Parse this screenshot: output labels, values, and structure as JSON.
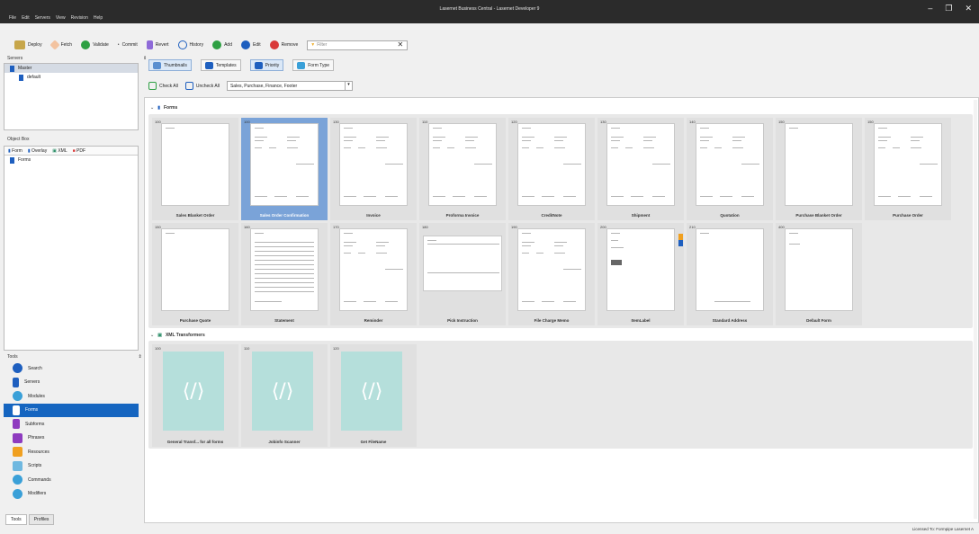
{
  "app": {
    "title": "Lasernet Business Central - Lasernet Developer 9",
    "menu": [
      "File",
      "Edit",
      "Servers",
      "View",
      "Revision",
      "Help"
    ],
    "window_buttons": [
      "–",
      "❐",
      "✕"
    ]
  },
  "toolbar": {
    "deploy": "Deploy",
    "fetch": "Fetch",
    "validate": "Validate",
    "commit": "Commit",
    "revert": "Revert",
    "history": "History",
    "add": "Add",
    "edit": "Edit",
    "remove": "Remove",
    "filter_placeholder": "Filter",
    "clear_icon": "✕"
  },
  "servers": {
    "header": "Servers",
    "pin": "⇕",
    "items": [
      {
        "label": "Master"
      },
      {
        "label": "default"
      }
    ]
  },
  "object_box": {
    "header": "Object Box",
    "pin": "⇕",
    "tabs": [
      "Form",
      "Overlay",
      "XML",
      "PDF"
    ],
    "items": [
      {
        "label": "Forms"
      }
    ]
  },
  "tools": {
    "header": "Tools",
    "pin": "⇕",
    "items": [
      {
        "label": "Search",
        "color": "#1e5fbf"
      },
      {
        "label": "Servers",
        "color": "#1e5fbf"
      },
      {
        "label": "Modules",
        "color": "#3aa0d8"
      },
      {
        "label": "Forms",
        "color": "#ffffff"
      },
      {
        "label": "Subforms",
        "color": "#8e3bbf"
      },
      {
        "label": "Phrases",
        "color": "#8e3bbf"
      },
      {
        "label": "Resources",
        "color": "#f0a020"
      },
      {
        "label": "Scripts",
        "color": "#3aa0d8"
      },
      {
        "label": "Commands",
        "color": "#3aa0d8"
      },
      {
        "label": "Modifiers",
        "color": "#3aa0d8"
      }
    ],
    "active_index": 3,
    "bottom_tabs": [
      "Tools",
      "Profiles"
    ]
  },
  "view": {
    "thumbnails": "Thumbnails",
    "templates": "Templates",
    "priority": "Priority",
    "form_type": "Form Type"
  },
  "check": {
    "check_all": "Check All",
    "uncheck_all": "Uncheck All",
    "combo_value": "Sales, Purchase, Finance, Footer"
  },
  "forms_group": {
    "label": "Forms",
    "cards": [
      {
        "priority": "100",
        "name": "Sales Blanket Order",
        "kind": "blank"
      },
      {
        "priority": "100",
        "name": "Sales Order Confirmation",
        "kind": "doc",
        "selected": true
      },
      {
        "priority": "130",
        "name": "Invoice",
        "kind": "doc"
      },
      {
        "priority": "110",
        "name": "Proforma Invoice",
        "kind": "doc"
      },
      {
        "priority": "120",
        "name": "CreditNote",
        "kind": "doc"
      },
      {
        "priority": "130",
        "name": "Shipment",
        "kind": "doc"
      },
      {
        "priority": "140",
        "name": "Quotation",
        "kind": "doc"
      },
      {
        "priority": "150",
        "name": "Purchase Blanket Order",
        "kind": "blank"
      },
      {
        "priority": "150",
        "name": "Purchase Order",
        "kind": "doc"
      },
      {
        "priority": "150",
        "name": "Purchase Quote",
        "kind": "blank"
      },
      {
        "priority": "160",
        "name": "Statement",
        "kind": "table"
      },
      {
        "priority": "170",
        "name": "Reminder",
        "kind": "doc"
      },
      {
        "priority": "180",
        "name": "Pick Instruction",
        "kind": "wide"
      },
      {
        "priority": "190",
        "name": "File Charge Memo",
        "kind": "doc"
      },
      {
        "priority": "200",
        "name": "ItemLabel",
        "kind": "label"
      },
      {
        "priority": "210",
        "name": "Standard Address",
        "kind": "blank"
      },
      {
        "priority": "400",
        "name": "Default Form",
        "kind": "blank"
      }
    ]
  },
  "xml_group": {
    "label": "XML Transformers",
    "glyph": "⟨/⟩",
    "cards": [
      {
        "priority": "100",
        "name": "General Transf... for all forms"
      },
      {
        "priority": "110",
        "name": "Jobinfo Scanner"
      },
      {
        "priority": "120",
        "name": "Get FileName"
      }
    ]
  },
  "status": {
    "license": "Licensed To: Formpipe Lasernet A"
  }
}
